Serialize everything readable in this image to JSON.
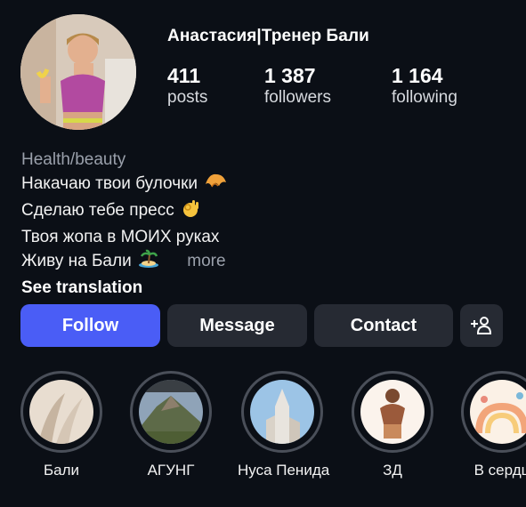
{
  "profile": {
    "username": "Анастасия|Тренер Бали",
    "stats": [
      {
        "value": "411",
        "label": "posts"
      },
      {
        "value": "1 387",
        "label": "followers"
      },
      {
        "value": "1 164",
        "label": "following"
      }
    ]
  },
  "bio": {
    "category": "Health/beauty",
    "lines": [
      "Накачаю твои булочки",
      "Сделаю тебе пресс",
      "Твоя жопа в МОИХ руках",
      "Живу на Бали"
    ],
    "more": "more",
    "see_translation": "See translation"
  },
  "actions": {
    "follow": "Follow",
    "message": "Message",
    "contact": "Contact",
    "add_user_icon": "+person"
  },
  "highlights": [
    {
      "label": "Бали"
    },
    {
      "label": "АГУНГ"
    },
    {
      "label": "Нуса Пенида"
    },
    {
      "label": "ЗД"
    },
    {
      "label": "В сердц"
    }
  ],
  "colors": {
    "background": "#0b0f16",
    "follow_button": "#4a5df6",
    "secondary_button": "#262a33"
  }
}
